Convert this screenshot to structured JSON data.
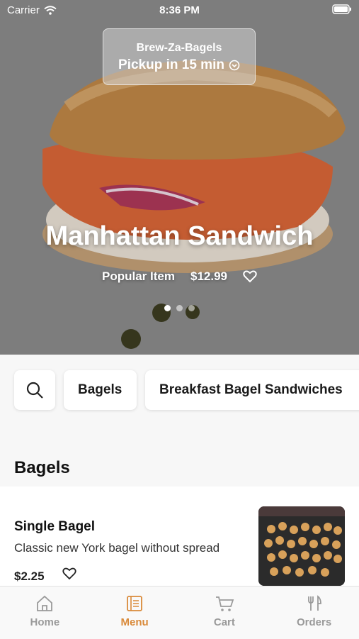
{
  "status_bar": {
    "carrier": "Carrier",
    "time": "8:36 PM"
  },
  "store": {
    "name": "Brew-Za-Bagels",
    "pickup": "Pickup in 15 min"
  },
  "hero": {
    "title": "Manhattan Sandwich",
    "tag": "Popular Item",
    "price": "$12.99",
    "slides": 3,
    "active_slide": 0
  },
  "categories": [
    "Bagels",
    "Breakfast Bagel Sandwiches"
  ],
  "section": {
    "title": "Bagels"
  },
  "items": [
    {
      "name": "Single Bagel",
      "description": "Classic new York bagel without spread",
      "price": "$2.25"
    }
  ],
  "tabs": [
    {
      "label": "Home",
      "icon": "home-icon"
    },
    {
      "label": "Menu",
      "icon": "menu-icon",
      "active": true
    },
    {
      "label": "Cart",
      "icon": "cart-icon"
    },
    {
      "label": "Orders",
      "icon": "orders-icon"
    }
  ],
  "colors": {
    "accent": "#d98a3a",
    "inactive": "#9a9a9a"
  }
}
